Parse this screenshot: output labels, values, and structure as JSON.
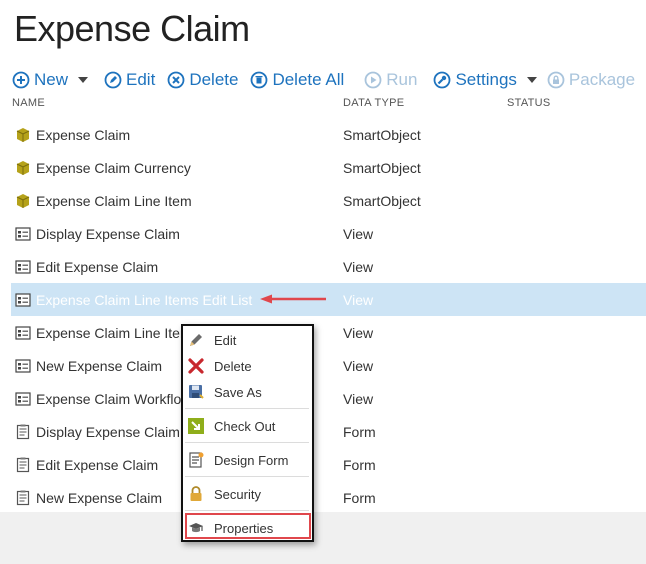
{
  "page": {
    "title": "Expense Claim"
  },
  "toolbar": {
    "new_label": "New",
    "edit_label": "Edit",
    "delete_label": "Delete",
    "delete_all_label": "Delete All",
    "run_label": "Run",
    "settings_label": "Settings",
    "package_label": "Package"
  },
  "columns": {
    "name": "NAME",
    "data_type": "DATA TYPE",
    "status": "STATUS"
  },
  "rows": [
    {
      "name": "Expense Claim",
      "type": "SmartObject",
      "icon": "smartobject-icon"
    },
    {
      "name": "Expense Claim Currency",
      "type": "SmartObject",
      "icon": "smartobject-icon"
    },
    {
      "name": "Expense Claim Line Item",
      "type": "SmartObject",
      "icon": "smartobject-icon"
    },
    {
      "name": "Display Expense Claim",
      "type": "View",
      "icon": "view-icon"
    },
    {
      "name": "Edit Expense Claim",
      "type": "View",
      "icon": "view-icon"
    },
    {
      "name": "Expense Claim Line Items Edit List",
      "type": "View",
      "icon": "view-icon",
      "selected": true
    },
    {
      "name": "Expense Claim Line Iter",
      "type": "View",
      "icon": "view-icon"
    },
    {
      "name": "New Expense Claim",
      "type": "View",
      "icon": "view-icon"
    },
    {
      "name": "Expense Claim Workflo",
      "type": "View",
      "icon": "view-icon"
    },
    {
      "name": "Display Expense Claim",
      "type": "Form",
      "icon": "form-icon"
    },
    {
      "name": "Edit Expense Claim",
      "type": "Form",
      "icon": "form-icon"
    },
    {
      "name": "New Expense Claim",
      "type": "Form",
      "icon": "form-icon"
    }
  ],
  "context_menu": {
    "edit": "Edit",
    "delete": "Delete",
    "save_as": "Save As",
    "check_out": "Check Out",
    "design_form": "Design Form",
    "security": "Security",
    "properties": "Properties"
  },
  "colors": {
    "accent": "#1e73be",
    "selected_row": "#cde4f5",
    "annotation_red": "#e0474c",
    "smartobject_icon": "#b5a21a"
  }
}
